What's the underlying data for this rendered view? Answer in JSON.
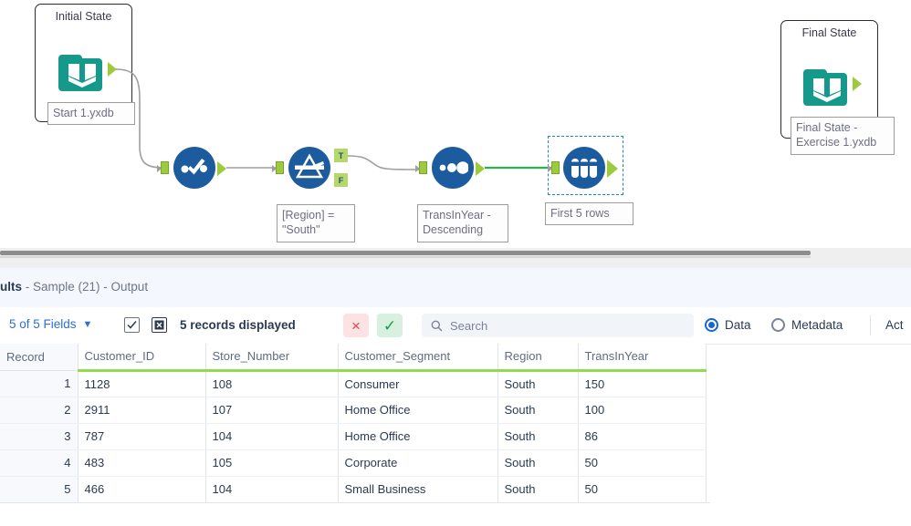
{
  "canvas": {
    "containers": [
      {
        "id": "initial-state",
        "title": "Initial State"
      },
      {
        "id": "final-state",
        "title": "Final State"
      }
    ],
    "tools": [
      {
        "id": "input-data",
        "icon": "book-icon",
        "label": "Start 1.yxdb"
      },
      {
        "id": "select",
        "icon": "select-tool-icon",
        "label": ""
      },
      {
        "id": "filter",
        "icon": "filter-tool-icon",
        "label": "[Region] =\n\"South\"",
        "anchor_true": "T",
        "anchor_false": "F"
      },
      {
        "id": "sort",
        "icon": "sort-tool-icon",
        "label": "TransInYear -\nDescending"
      },
      {
        "id": "sample",
        "icon": "sample-tool-icon",
        "label": "First 5 rows",
        "selected": true
      },
      {
        "id": "output-data",
        "icon": "book-icon",
        "label": "Final State -\nExercise 1.yxdb"
      }
    ],
    "colors": {
      "tool_blue": "#1c5c9e",
      "anchor_green": "#9ccb3b",
      "book_teal": "#14998b",
      "connection_gray": "#9e9e9e",
      "connection_active_green": "#2bb24c",
      "selection_blue": "#1f7fe0"
    }
  },
  "results": {
    "title_bold": "ults",
    "title_rest": " - Sample (21) - Output",
    "toolbar": {
      "fields_label": "5 of 5 Fields",
      "chevron": "chevron-down-icon",
      "select_all_icon": "checkbox-checked-icon",
      "deselect_all_icon": "checkbox-x-icon",
      "records_label": "5 records displayed",
      "cancel_label": "×",
      "apply_label": "✓",
      "search_placeholder": "Search",
      "search_value": "",
      "data_label": "Data",
      "metadata_label": "Metadata",
      "selected_view": "Data",
      "actions_label": "Act"
    },
    "grid": {
      "columns": [
        "Record",
        "Customer_ID",
        "Store_Number",
        "Customer_Segment",
        "Region",
        "TransInYear"
      ],
      "rows": [
        [
          "1",
          "1128",
          "108",
          "Consumer",
          "South",
          "150"
        ],
        [
          "2",
          "2911",
          "107",
          "Home Office",
          "South",
          "100"
        ],
        [
          "3",
          "787",
          "104",
          "Home Office",
          "South",
          "86"
        ],
        [
          "4",
          "483",
          "105",
          "Corporate",
          "South",
          "50"
        ],
        [
          "5",
          "466",
          "104",
          "Small Business",
          "South",
          "50"
        ]
      ]
    }
  }
}
